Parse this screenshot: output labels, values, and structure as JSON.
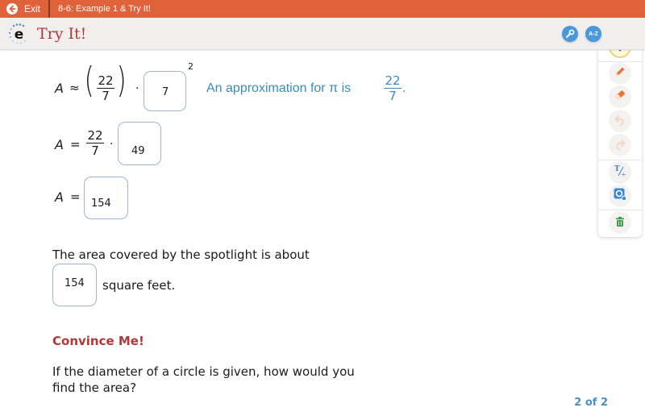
{
  "topbar": {
    "exit_label": "Exit",
    "lesson_title": "8-6: Example 1 & Try It!",
    "bg_color": "#e0623a"
  },
  "header": {
    "title": "Try It!",
    "icons": [
      "wrench-icon",
      "glossary-az-icon"
    ],
    "glossary_label": "A-Z"
  },
  "equations": {
    "line1": {
      "lhs": "A",
      "op": "≈",
      "frac_num": "22",
      "frac_den": "7",
      "dot": "·",
      "box_value": "7",
      "exponent": "2"
    },
    "hint": {
      "text": "An approximation for π  is",
      "frac_num": "22",
      "frac_den": "7",
      "period": "."
    },
    "line2": {
      "lhs": "A",
      "op": "=",
      "frac_num": "22",
      "frac_den": "7",
      "dot": "·",
      "box_value": "49"
    },
    "line3": {
      "lhs": "A",
      "op": "=",
      "box_value": "154"
    }
  },
  "statement": {
    "line1": "The area covered by the spotlight is about",
    "box_value": "154",
    "suffix": "square feet."
  },
  "convince": {
    "heading": "Convince Me!",
    "question_line1": "If the diameter of a circle is given, how would you",
    "question_line2": "find the area?"
  },
  "pager": {
    "text": "2 of 2",
    "current": 2,
    "total": 2
  },
  "toolbar": {
    "tools": [
      "highlighter-icon",
      "pencil-icon",
      "eraser-icon",
      "undo-icon",
      "redo-icon",
      "text-math-icon",
      "zoom-icon",
      "trash-icon"
    ]
  },
  "colors": {
    "accent_orange": "#e0623a",
    "title_red": "#b0383b",
    "hint_blue": "#3b8cb9",
    "icon_blue": "#4a98d9",
    "trash_green": "#3a9a48"
  }
}
